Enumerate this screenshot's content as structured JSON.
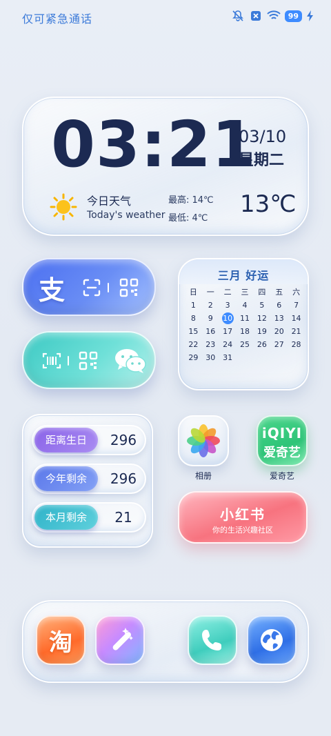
{
  "status_bar": {
    "carrier_text": "仅可紧急通话",
    "battery": "99",
    "icons": [
      "mute-icon",
      "no-sim-icon",
      "wifi-icon",
      "battery-icon",
      "charging-icon"
    ]
  },
  "clock": {
    "time": "03:21",
    "date": "03/10",
    "weekday": "星期二"
  },
  "weather": {
    "title": "今日天气",
    "subtitle": "Today's weather",
    "high": "最高:  14℃",
    "low": "最低:    4℃",
    "temp": "13℃",
    "icon": "sun-icon"
  },
  "pay": {
    "alipay_char": "支",
    "alipay_icons": [
      "alipay-icon",
      "scan-icon",
      "qr-code-icon"
    ],
    "wechat_icons": [
      "barcode-icon",
      "qr-code-icon",
      "wechat-icon"
    ]
  },
  "calendar": {
    "title": "三月 好运",
    "weekdays": [
      "日",
      "一",
      "二",
      "三",
      "四",
      "五",
      "六"
    ],
    "today": "10",
    "weeks": [
      [
        "1",
        "2",
        "3",
        "4",
        "5",
        "6",
        "7"
      ],
      [
        "8",
        "9",
        "10",
        "11",
        "12",
        "13",
        "14"
      ],
      [
        "15",
        "16",
        "17",
        "18",
        "19",
        "20",
        "21"
      ],
      [
        "22",
        "23",
        "24",
        "25",
        "26",
        "27",
        "28"
      ],
      [
        "29",
        "30",
        "31",
        "",
        "",
        "",
        ""
      ]
    ]
  },
  "countdown": [
    {
      "label": "距离生日",
      "value": "296",
      "color": "#8a63e8"
    },
    {
      "label": "今年剩余",
      "value": "296",
      "color": "#5b78ea"
    },
    {
      "label": "本月剩余",
      "value": "21",
      "color": "#2fb3c9"
    }
  ],
  "apps": {
    "photos": {
      "label": "相册",
      "icon": "photos-icon"
    },
    "iqiyi": {
      "label": "爱奇艺",
      "logo_text": "iQIYI",
      "logo_sub": "爱奇艺"
    },
    "xiaohongshu": {
      "title": "小红书",
      "subtitle": "你的生活兴趣社区"
    }
  },
  "dock": [
    {
      "name": "taobao",
      "icon": "taobao-icon",
      "glyph": "淘"
    },
    {
      "name": "theme",
      "icon": "magic-wand-icon"
    },
    {
      "name": "phone",
      "icon": "phone-icon"
    },
    {
      "name": "browser",
      "icon": "globe-icon"
    }
  ],
  "colors": {
    "accent": "#3d8bff",
    "alipay": "#4b6ff0",
    "wechat": "#3cc9c3",
    "xiaohongshu": "#f7737f",
    "iqiyi": "#2fc478",
    "taobao": "#ff6a2a"
  }
}
